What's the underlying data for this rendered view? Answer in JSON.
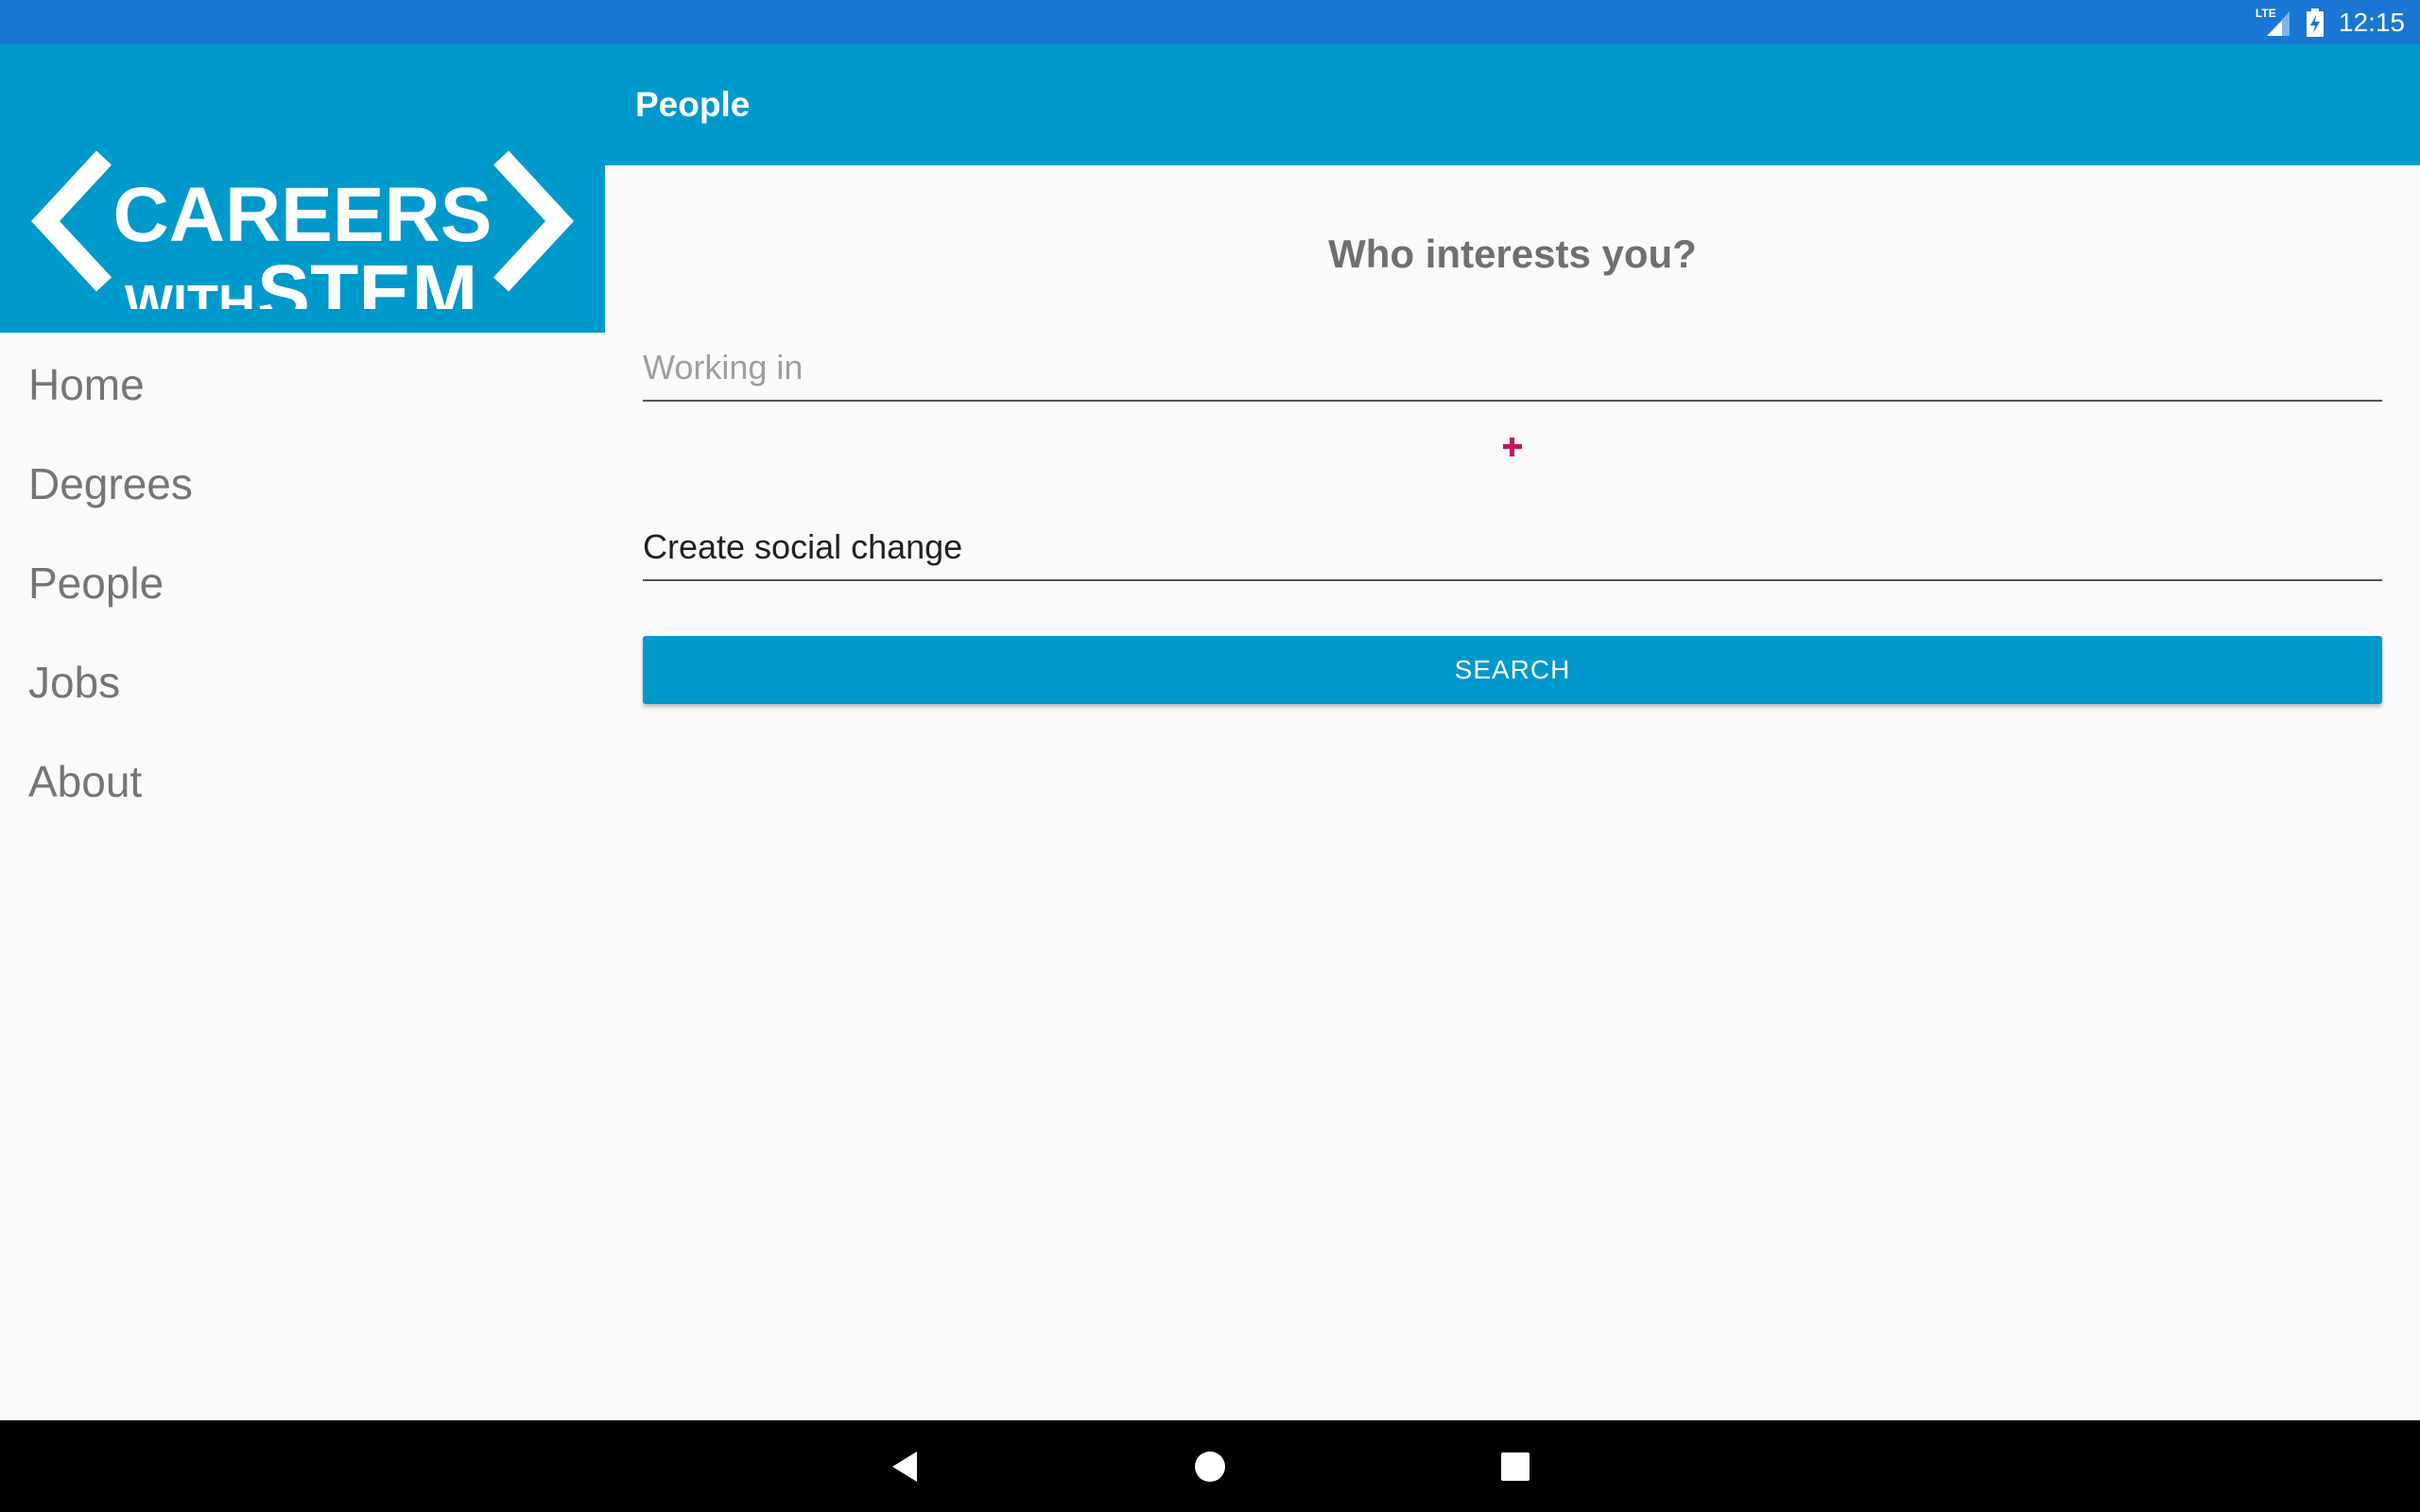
{
  "status_bar": {
    "time": "12:15",
    "network": "LTE",
    "icons": [
      "signal-icon",
      "battery-charging-icon"
    ]
  },
  "drawer": {
    "logo": {
      "line1": "CAREERS",
      "line2_small": "WITH",
      "line2_large": "STEM"
    },
    "items": [
      {
        "label": "Home"
      },
      {
        "label": "Degrees"
      },
      {
        "label": "People"
      },
      {
        "label": "Jobs"
      },
      {
        "label": "About"
      }
    ]
  },
  "app_bar": {
    "title": "People"
  },
  "main": {
    "heading": "Who interests you?",
    "working_in": {
      "value": "",
      "placeholder": "Working in"
    },
    "combine_icon": "plus-icon",
    "goal": {
      "value": "Create social change",
      "placeholder": ""
    },
    "search_label": "SEARCH"
  },
  "navigation_bar": {
    "icons": [
      "back-icon",
      "home-icon",
      "recents-icon"
    ]
  },
  "colors": {
    "status_bar": "#1976d2",
    "primary": "#0099cc",
    "accent": "#c2185b",
    "background": "#fafafa",
    "nav_text": "#757575"
  }
}
